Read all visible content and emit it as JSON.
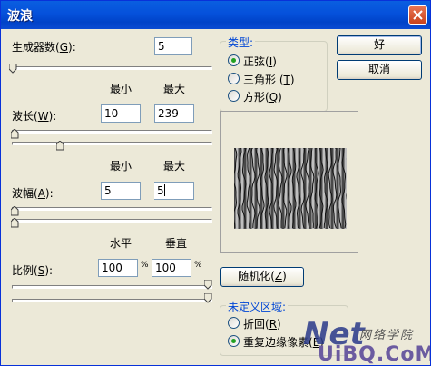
{
  "window": {
    "title": "波浪"
  },
  "generators": {
    "label": "生成器数",
    "hotkey": "G",
    "value": "5"
  },
  "wavelength": {
    "label": "波长",
    "hotkey": "W",
    "min_header": "最小",
    "max_header": "最大",
    "min": "10",
    "max": "239"
  },
  "amplitude": {
    "label": "波幅",
    "hotkey": "A",
    "min_header": "最小",
    "max_header": "最大",
    "min": "5",
    "max": "5"
  },
  "scale": {
    "label": "比例",
    "hotkey": "S",
    "h_header": "水平",
    "v_header": "垂直",
    "h": "100",
    "v": "100",
    "unit": "%"
  },
  "type_group": {
    "title": "类型",
    "options": [
      {
        "label": "正弦",
        "hotkey": "I",
        "selected": true
      },
      {
        "label": "三角形",
        "hotkey": "T",
        "selected": false
      },
      {
        "label": "方形",
        "hotkey": "Q",
        "selected": false
      }
    ]
  },
  "buttons": {
    "ok": "好",
    "cancel": "取消",
    "randomize": "随机化",
    "randomize_hotkey": "Z"
  },
  "undefined_group": {
    "title": "未定义区域",
    "options": [
      {
        "label": "折回",
        "hotkey": "R",
        "selected": false
      },
      {
        "label": "重复边缘像素",
        "hotkey": "E",
        "selected": true
      }
    ]
  },
  "watermark": {
    "site": "UiBQ.CoM",
    "chinese": "网络学院",
    "logo": "Net"
  },
  "colors": {
    "title_bar": "#0054e3",
    "dialog_bg": "#ece9d8",
    "group_title": "#0046d5",
    "radio_dot": "#21a121"
  }
}
